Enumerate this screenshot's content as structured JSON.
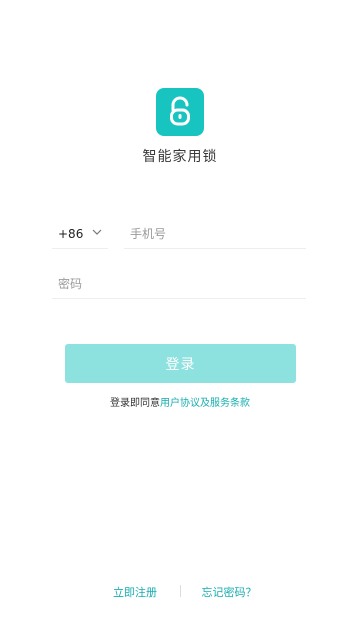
{
  "app": {
    "name": "智能家用锁",
    "logo_icon": "padlock-icon",
    "brand_color": "#17c4bf"
  },
  "form": {
    "country_code": "+86",
    "phone_placeholder": "手机号",
    "password_placeholder": "密码",
    "login_label": "登录",
    "login_button_color": "#8de2e0"
  },
  "agreement": {
    "prefix": "登录即同意",
    "link": "用户协议及服务条款"
  },
  "footer": {
    "register_label": "立即注册",
    "forgot_label": "忘记密码？"
  }
}
